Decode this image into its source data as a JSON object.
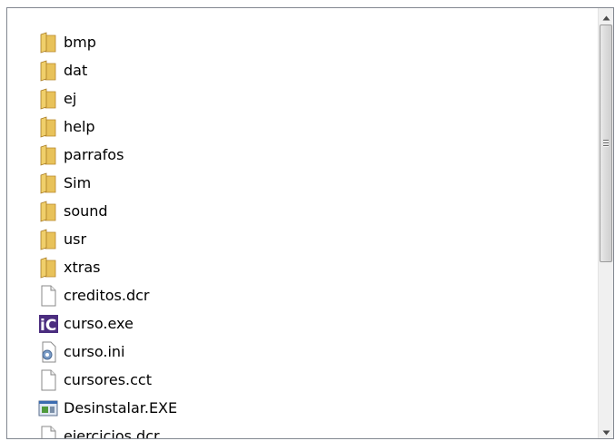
{
  "files": [
    {
      "name": "bmp",
      "icon": "folder-icon"
    },
    {
      "name": "dat",
      "icon": "folder-icon"
    },
    {
      "name": "ej",
      "icon": "folder-icon"
    },
    {
      "name": "help",
      "icon": "folder-icon"
    },
    {
      "name": "parrafos",
      "icon": "folder-icon"
    },
    {
      "name": "Sim",
      "icon": "folder-icon"
    },
    {
      "name": "sound",
      "icon": "folder-icon"
    },
    {
      "name": "usr",
      "icon": "folder-icon"
    },
    {
      "name": "xtras",
      "icon": "folder-icon"
    },
    {
      "name": "creditos.dcr",
      "icon": "file-icon"
    },
    {
      "name": "curso.exe",
      "icon": "app-ic-icon"
    },
    {
      "name": "curso.ini",
      "icon": "settings-file-icon"
    },
    {
      "name": "cursores.cct",
      "icon": "file-icon"
    },
    {
      "name": "Desinstalar.EXE",
      "icon": "installer-icon"
    },
    {
      "name": "ejercicios.dcr",
      "icon": "file-icon"
    }
  ],
  "colors": {
    "folder_front": "#e8c25a",
    "folder_back": "#c99a2e",
    "app_ic": "#4b2d7f",
    "border": "#828790"
  },
  "scrollbar": {
    "up_icon": "scroll-up-arrow-icon",
    "down_icon": "scroll-down-arrow-icon"
  }
}
